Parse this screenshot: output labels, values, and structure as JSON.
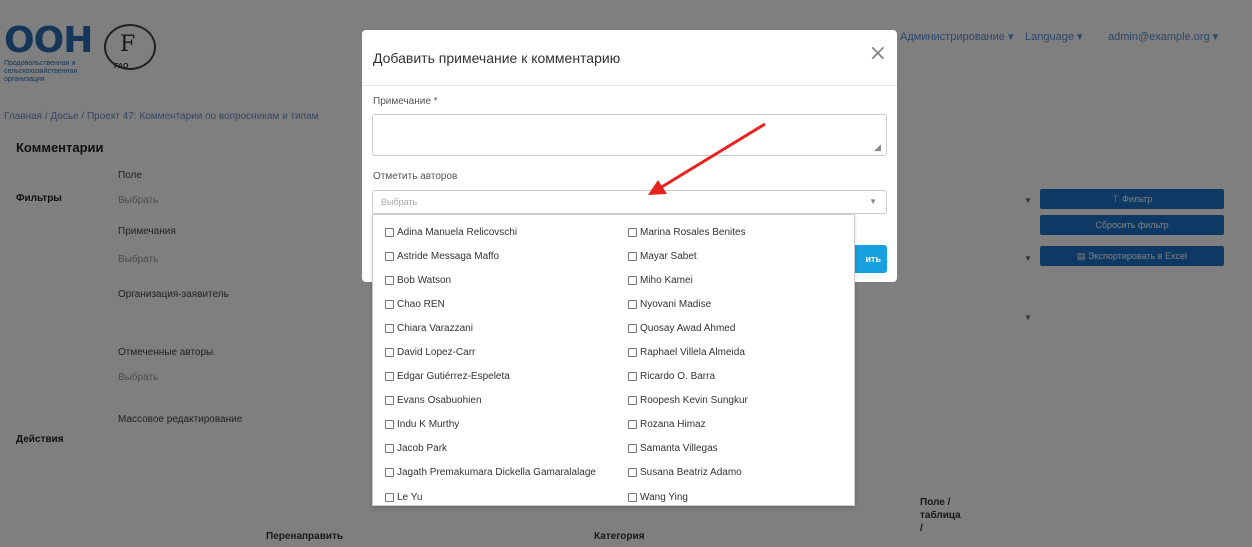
{
  "background": {
    "logo_un_text": "ООН",
    "logo_un_sub": "Продовольственная и сельскохозяйственная организация",
    "logo_emblem_letter": "F",
    "logo_emblem_text": "FAO",
    "nav": [
      "Администрирование ▾",
      "Language ▾",
      "admin@example.org ▾"
    ],
    "breadcrumb": "Главная / Досье / Проект 47: Комментарии по вопросникам и типам",
    "page_heading": "Комментарии",
    "filters_label": "Фильтры",
    "actions_label": "Действия",
    "field_labels": [
      "Поле",
      "Примечания",
      "Организация-заявитель",
      "Отмеченные авторы",
      "Массовое редактирование"
    ],
    "field_placeholder": "Выбрать",
    "filter_button": "Фильтр",
    "reset_button": "Сбросить фильтр",
    "export_button": "Экспортировать в Excel",
    "table_headers": {
      "rephrase": "Перенаправить",
      "category": "Категория",
      "field_table": "Поле / таблица /"
    }
  },
  "modal": {
    "title": "Добавить примечание к комментарию",
    "close_glyph": "×",
    "note_label": "Примечание *",
    "note_value": "",
    "authors_label": "Отметить авторов",
    "authors_placeholder": "Выбрать",
    "submit_label": "ить"
  },
  "dropdown": {
    "left_options": [
      "Adina Manuela Relicovschi",
      "Astride Messaga Maffo",
      "Bob Watson",
      "Chao REN",
      "Chiara Varazzani",
      "David Lopez-Carr",
      "Edgar Gutiérrez-Espeleta",
      "Evans Osabuohien",
      "Indu K Murthy",
      "Jacob Park",
      "Jagath Premakumara Dickella Gamaralalage",
      "Le Yu"
    ],
    "right_options": [
      "Marina Rosales Benites",
      "Mayar Sabet",
      "Miho Kamei",
      "Nyovani Madise",
      "Quosay Awad Ahmed",
      "Raphael Villela Almeida",
      "Ricardo O. Barra",
      "Roopesh Kevin Sungkur",
      "Rozana Himaz",
      "Samanta Villegas",
      "Susana Beatriz Adamo",
      "Wang Ying"
    ]
  },
  "colors": {
    "accent": "#16a0e0",
    "annotation_arrow": "#e8231f"
  }
}
